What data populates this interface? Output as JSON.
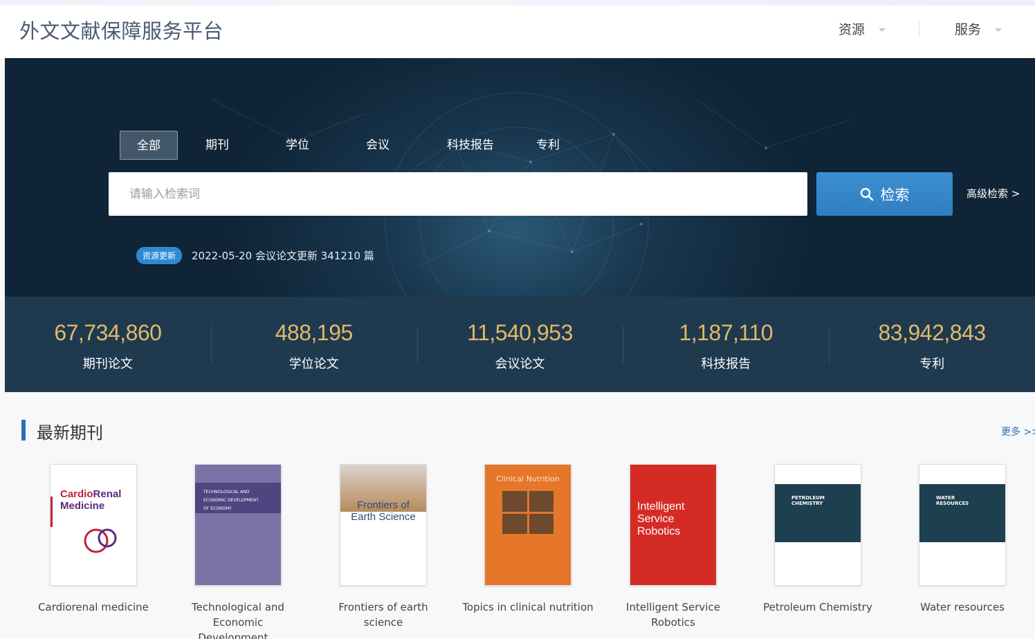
{
  "header": {
    "logo": "外文文献保障服务平台",
    "nav": [
      {
        "label": "资源"
      },
      {
        "label": "服务"
      }
    ]
  },
  "search": {
    "tabs": [
      {
        "label": "全部",
        "active": true
      },
      {
        "label": "期刊"
      },
      {
        "label": "学位"
      },
      {
        "label": "会议"
      },
      {
        "label": "科技报告"
      },
      {
        "label": "专利"
      }
    ],
    "placeholder": "请输入检索词",
    "button_label": "检索",
    "advanced_label": "高级检索 >",
    "update_badge": "资源更新",
    "update_text": "2022-05-20 会议论文更新 341210 篇"
  },
  "stats": [
    {
      "value": "67,734,860",
      "label": "期刊论文"
    },
    {
      "value": "488,195",
      "label": "学位论文"
    },
    {
      "value": "11,540,953",
      "label": "会议论文"
    },
    {
      "value": "1,187,110",
      "label": "科技报告"
    },
    {
      "value": "83,942,843",
      "label": "专利"
    }
  ],
  "latest": {
    "title": "最新期刊",
    "more_label": "更多 >>",
    "journals": [
      {
        "title": "Cardiorenal medicine",
        "cover_text": [
          "Cardio",
          "Renal",
          "Medicine"
        ]
      },
      {
        "title": "Technological and Economic Development...",
        "cover_text": [
          "TECHNOLOGICAL AND",
          "ECONOMIC DEVELOPMENT",
          "OF ECONOMY"
        ]
      },
      {
        "title": "Frontiers of earth science",
        "cover_text": [
          "Frontiers of",
          "Earth Science"
        ]
      },
      {
        "title": "Topics in clinical nutrition",
        "cover_text": [
          "Clinical Nutrition"
        ]
      },
      {
        "title": "Intelligent Service Robotics",
        "cover_text": [
          "Intelligent",
          "Service",
          "Robotics"
        ]
      },
      {
        "title": "Petroleum Chemistry",
        "cover_text": [
          "PETROLEUM",
          "CHEMISTRY"
        ]
      },
      {
        "title": "Water resources",
        "cover_text": [
          "WATER",
          "RESOURCES"
        ]
      }
    ]
  },
  "colors": {
    "accent": "#2c6fb0",
    "stat_number": "#e2b96a",
    "hero_dark": "#0f2436"
  }
}
